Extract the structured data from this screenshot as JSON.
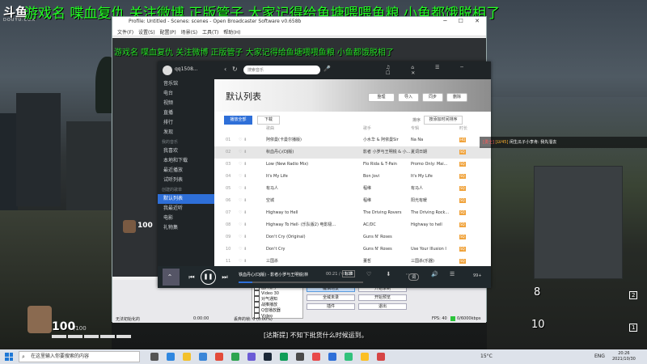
{
  "stream": {
    "logo": "斗鱼",
    "logo_sub": "DOUYU.COM",
    "banner": "游戏名 喋血复仇 关注微博 正版管子 大家记得给鱼塘喂喂鱼粮 小鱼都饿脱相了",
    "caption": "[达斯提] 不知下批货什么时候运到。",
    "chat": {
      "badge": "[勇士]",
      "level": "[LV45]",
      "text": "闲生瓜子小李肯: 我先溜去"
    },
    "hud_health": "100",
    "hud_health_max": "/100",
    "hud_health_small": "100",
    "ammo_1": "8",
    "ammo_2": "10",
    "slot_1": "2",
    "slot_2": "1"
  },
  "obs": {
    "title": "Profile: Untitled - Scenes: scenes - Open Broadcaster Software v0.658b",
    "menu": "文件(F) 设置(S) 配置(P) 场景(S) 工具(T) 帮助(H)",
    "ticker": "游戏名 喋血复仇 关注微博 正版管子 大家记得给鱼塘喂喂鱼粮 小鱼都饿脱相了",
    "sources": [
      "图片素子",
      "Video 30",
      "对气通知",
      "战推播放",
      "Q音播放器",
      "Video"
    ],
    "buttons": [
      "编辑场景",
      "开始录制",
      "全域未录",
      "开始预览",
      "插件",
      "退出"
    ],
    "status": "无法初始化的",
    "time": "0:00:00",
    "drop": "丢弃的帧: 0 (0.00%)",
    "fps": "FPS: 40",
    "bitrate": "0/6000kbps"
  },
  "music": {
    "user": "qq1508...",
    "search_placeholder": "搜索音乐",
    "sidebar": {
      "nav": [
        "音乐馆",
        "电台",
        "视频",
        "直播",
        "排行",
        "发现"
      ],
      "section_my": "我的音乐",
      "my": [
        "我喜欢",
        "本地和下载",
        "最近播放",
        "试听列表"
      ],
      "section_created": "创建的歌单",
      "created": [
        "默认列表",
        "我最近听",
        "电影",
        "礼物集"
      ]
    },
    "hero": {
      "title": "默认列表",
      "buttons": [
        "整理",
        "导入",
        "同步",
        "删除"
      ]
    },
    "toolbar": {
      "play_all": "播放全部",
      "download": "下载",
      "sort": "排序",
      "sort_select": "按添加时间排序"
    },
    "table": {
      "headers": [
        "歌曲",
        "歌手",
        "专辑",
        "时长"
      ],
      "rows": [
        {
          "n": "01",
          "title": "阿依曼(卡曼尔播版)",
          "artist": "小水华 & 阿依曼Sir",
          "album": "Na Na",
          "q": "HQ"
        },
        {
          "n": "02",
          "title": "秋血丹心(DJ版)",
          "artist": "影者 小罗与王明锐 & 小...",
          "album": "夏词日期",
          "q": "SQ"
        },
        {
          "n": "03",
          "title": "Low (New Radio Mix)",
          "artist": "Flo Rida & T-Pain",
          "album": "Promo Only: Mai...",
          "q": "SQ"
        },
        {
          "n": "04",
          "title": "It's My Life",
          "artist": "Bon Jovi",
          "album": "It's My Life",
          "q": "SQ"
        },
        {
          "n": "05",
          "title": "有马人",
          "artist": "程维",
          "album": "有马人",
          "q": "SQ"
        },
        {
          "n": "06",
          "title": "空城",
          "artist": "程维",
          "album": "阳光有暖",
          "q": "SQ"
        },
        {
          "n": "07",
          "title": "Highway to Hell",
          "artist": "The Driving Rovers",
          "album": "The Driving Rock...",
          "q": "SQ"
        },
        {
          "n": "08",
          "title": "Highway To Hell· (乐队版2) 电影极...",
          "artist": "AC/DC",
          "album": "Highway to hell",
          "q": "SQ"
        },
        {
          "n": "09",
          "title": "Don't Cry (Original)",
          "artist": "Guns N' Roses",
          "album": "",
          "q": "SQ"
        },
        {
          "n": "10",
          "title": "Don't Cry",
          "artist": "Guns N' Roses",
          "album": "Use Your Illusion I",
          "q": "SQ"
        },
        {
          "n": "11",
          "title": "三国杀",
          "artist": "董哲",
          "album": "三国杀(乐器)",
          "q": "SQ"
        }
      ]
    },
    "player": {
      "now_playing": "铁血丹心(DJ版) - 影者小罗与王明锐(林",
      "time": "00:21 / 03:13",
      "quality": "标准",
      "lyric_btn": "词",
      "count": "99+"
    }
  },
  "taskbar": {
    "search_placeholder": "在这里输入你要搜索的内容",
    "temperature": "15°C",
    "lang": "ENG",
    "time": "20:26",
    "date": "2021/10/30"
  },
  "colors": {
    "banner_green": "#22ff22",
    "accent_blue": "#2e6fd8",
    "quality_orange": "#f0a23a"
  }
}
